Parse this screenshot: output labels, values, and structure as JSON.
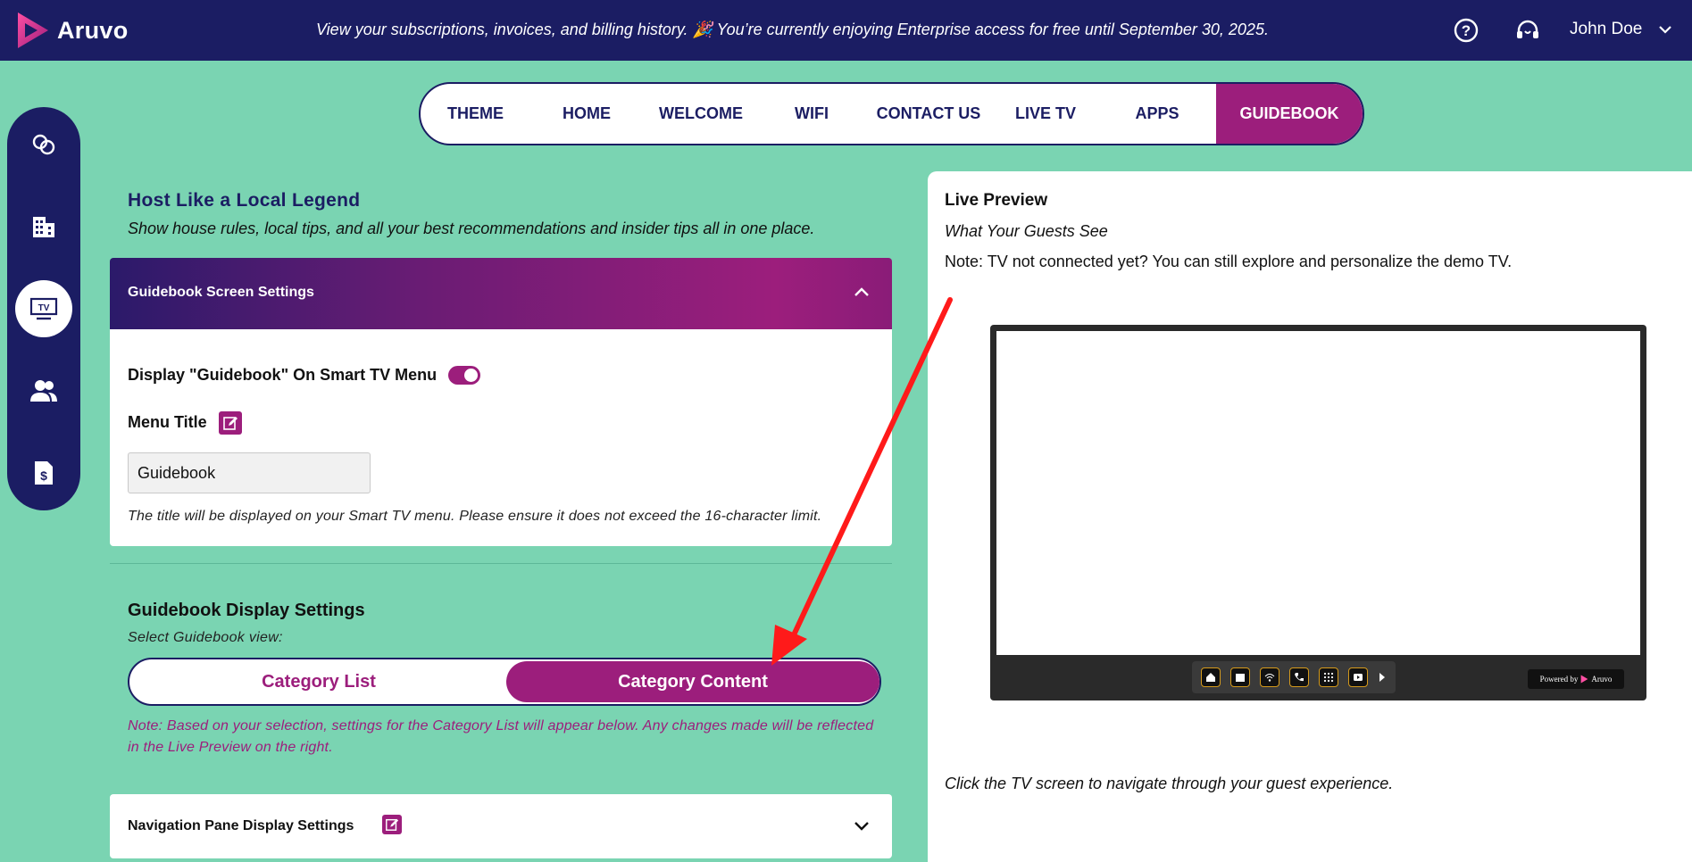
{
  "header": {
    "brand": "Aruvo",
    "banner": "View your subscriptions, invoices, and billing history. 🎉 You’re currently enjoying Enterprise access for free until September 30, 2025.",
    "user_name": "John Doe",
    "icons": [
      "help-icon",
      "support-headset-icon",
      "chevron-down-icon"
    ]
  },
  "sidebar": {
    "items": [
      {
        "icon": "link-circles-icon",
        "active": false
      },
      {
        "icon": "building-icon",
        "active": false
      },
      {
        "icon": "tv-icon",
        "label": "TV",
        "active": true
      },
      {
        "icon": "users-icon",
        "active": false
      },
      {
        "icon": "invoice-dollar-icon",
        "active": false
      }
    ]
  },
  "tabs": [
    {
      "label": "THEME"
    },
    {
      "label": "HOME"
    },
    {
      "label": "WELCOME"
    },
    {
      "label": "WIFI"
    },
    {
      "label": "CONTACT US"
    },
    {
      "label": "LIVE TV"
    },
    {
      "label": "APPS"
    },
    {
      "label": "GUIDEBOOK",
      "active": true
    }
  ],
  "main": {
    "heading": "Host Like a Local Legend",
    "subheading": "Show house rules, local tips, and all your best recommendations and insider tips all in one place.",
    "screen_settings": {
      "title": "Guidebook Screen Settings",
      "display_label": "Display \"Guidebook\" On Smart TV Menu",
      "display_enabled": true,
      "menu_title_label": "Menu Title",
      "menu_title_value": "Guidebook",
      "hint": "The title will be displayed on your Smart TV menu. Please ensure it does not exceed the 16-character limit."
    },
    "display_settings": {
      "title": "Guidebook Display Settings",
      "subtitle": "Select Guidebook view:",
      "options": [
        "Category List",
        "Category Content"
      ],
      "selected": "Category Content",
      "note": "Note: Based on your selection, settings for the Category List will appear below. Any changes made will be reflected in the Live Preview on the right."
    },
    "nav_pane": {
      "title": "Navigation Pane Display Settings"
    }
  },
  "preview": {
    "title": "Live Preview",
    "subtitle": "What Your Guests See",
    "note": "Note: TV not connected yet? You can still explore and personalize the demo TV.",
    "footer": "Click the TV screen to navigate through your guest experience.",
    "tv_bar_icons": [
      "home-icon",
      "folder-icon",
      "wifi-icon",
      "phone-icon",
      "grid-icon",
      "youtube-icon",
      "arrow-right-icon"
    ],
    "powered_by": "Powered by",
    "powered_brand": "Aruvo"
  },
  "colors": {
    "navy": "#1b1d63",
    "magenta": "#9c1e7c",
    "mint": "#7ad4b2",
    "annotation_arrow": "#ff1a1a"
  }
}
